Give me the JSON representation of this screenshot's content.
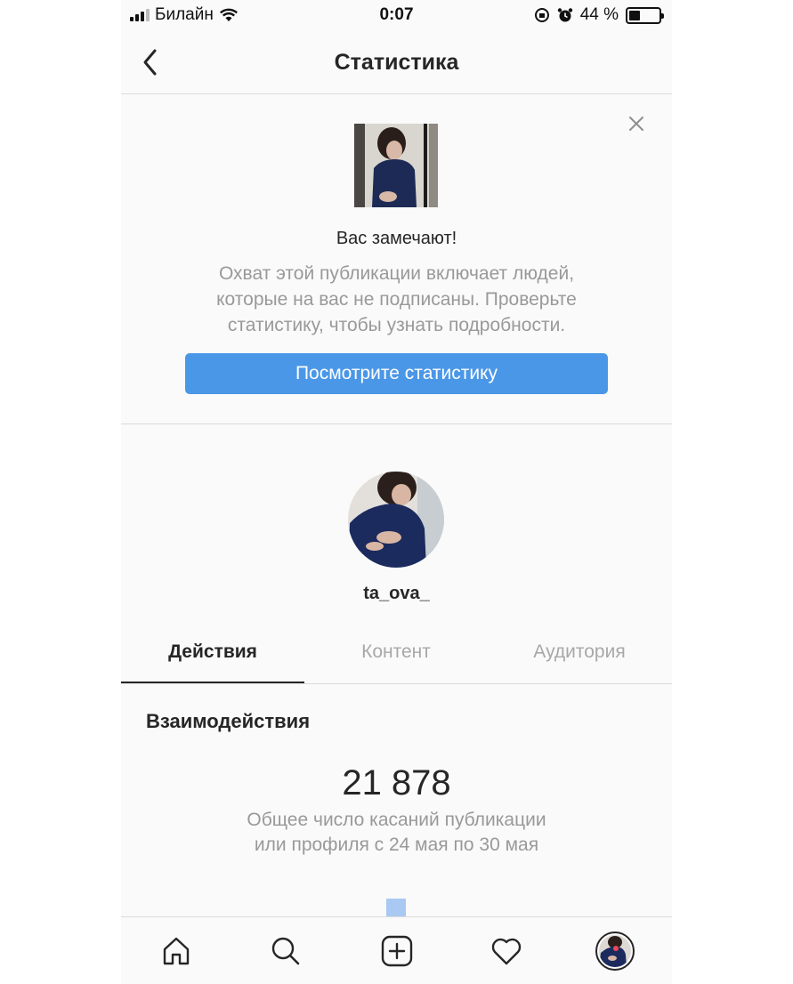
{
  "status_bar": {
    "carrier": "Билайн",
    "time": "0:07",
    "battery": "44 %",
    "battery_level": 0.44,
    "icons": [
      "signal-icon",
      "wifi-icon",
      "rotation-lock-icon",
      "alarm-icon",
      "battery-icon"
    ]
  },
  "nav": {
    "title": "Статистика",
    "back_icon": "chevron-left-icon"
  },
  "promo": {
    "title": "Вас замечают!",
    "text_lines": [
      "Охват этой публикации включает людей,",
      "которые на вас не подписаны. Проверьте",
      "статистику, чтобы узнать подробности."
    ],
    "button": "Посмотрите статистику",
    "close_icon": "close-icon"
  },
  "profile": {
    "username": "ta_ova_"
  },
  "tabs": [
    {
      "label": "Действия",
      "active": true
    },
    {
      "label": "Контент",
      "active": false
    },
    {
      "label": "Аудитория",
      "active": false
    }
  ],
  "interactions": {
    "title": "Взаимодействия",
    "total": "21 878",
    "desc_lines": [
      "Общее число касаний публикации",
      "или профиля с 24 мая по 30 мая"
    ]
  },
  "tabbar": {
    "items": [
      "home-icon",
      "search-icon",
      "new-post-icon",
      "activity-heart-icon",
      "profile-avatar"
    ]
  },
  "colors": {
    "accent": "#4a97e8",
    "text": "#262626",
    "muted": "#999999",
    "divider": "#dbdbdb",
    "background": "#fafafa",
    "chart_bar": "#a9c9f3"
  }
}
